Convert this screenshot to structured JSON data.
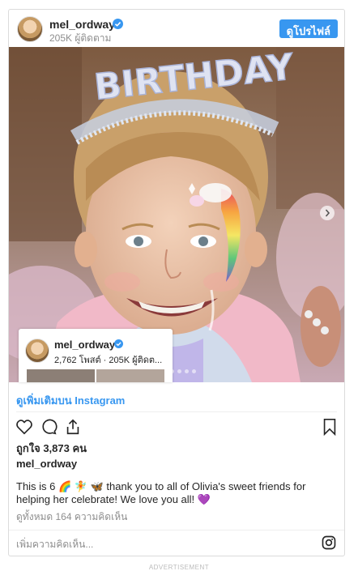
{
  "header": {
    "username": "mel_ordway",
    "followers": "205K ผู้ติดตาม",
    "profile_button": "ดูโปรไฟล์"
  },
  "photo": {
    "tiara_text": "BIRTHDAY"
  },
  "mini_profile": {
    "username": "mel_ordway",
    "stats": "2,762 โพสต์ · 205K ผู้ติดต..."
  },
  "view_more": "ดูเพิ่มเติมบน Instagram",
  "likes": "ถูกใจ 3,873 คน",
  "caption": {
    "username": "mel_ordway",
    "text": "This is 6 🌈 🧚 🦋 thank you to all of Olivia's sweet friends for helping her celebrate! We love you all! 💜"
  },
  "view_comments": "ดูทั้งหมด 164 ความคิดเห็น",
  "comment_placeholder": "เพิ่มความคิดเห็น...",
  "footer": {
    "advertisement": "ADVERTISEMENT"
  },
  "colors": {
    "link_blue": "#3897f0",
    "text": "#262626",
    "muted": "#8e8e8e"
  },
  "icons": [
    "verified-badge-icon",
    "heart-icon",
    "comment-icon",
    "share-icon",
    "bookmark-icon",
    "instagram-icon",
    "next-arrow-icon"
  ]
}
